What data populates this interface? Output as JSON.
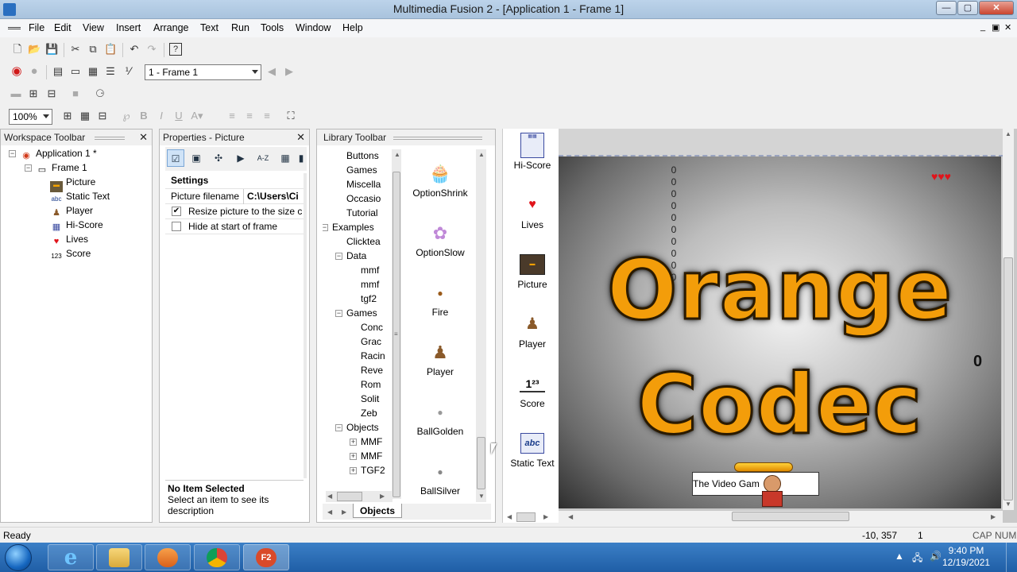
{
  "window": {
    "title": "Multimedia Fusion 2 - [Application 1 - Frame 1]",
    "min": "—",
    "max": "▢",
    "close": "✕",
    "mdi_min": "_",
    "mdi_restore": "▣",
    "mdi_close": "✕"
  },
  "menu": [
    "File",
    "Edit",
    "View",
    "Insert",
    "Arrange",
    "Text",
    "Run",
    "Tools",
    "Window",
    "Help"
  ],
  "toolbar": {
    "frame_select": "1 - Frame 1",
    "zoom": "100%"
  },
  "workspace": {
    "title": "Workspace Toolbar",
    "close": "✕",
    "application": "Application 1 *",
    "frame": "Frame 1",
    "objects": [
      {
        "label": "Picture",
        "icon": "picture-icon"
      },
      {
        "label": "Static Text",
        "icon": "static-text-icon"
      },
      {
        "label": "Player",
        "icon": "player-icon"
      },
      {
        "label": "Hi-Score",
        "icon": "hi-score-icon"
      },
      {
        "label": "Lives",
        "icon": "heart-icon"
      },
      {
        "label": "Score",
        "icon": "score-icon"
      }
    ]
  },
  "properties": {
    "title": "Properties - Picture",
    "close": "✕",
    "section": "Settings",
    "filename_label": "Picture filename",
    "filename_value": "C:\\Users\\Ci",
    "resize_label": "Resize picture to the size c",
    "resize_checked": "✔",
    "hide_label": "Hide at start of frame",
    "desc_title": "No Item Selected",
    "desc_text": "Select an item to see its description"
  },
  "library": {
    "title": "Library Toolbar",
    "tree": [
      {
        "label": "Buttons",
        "level": 2
      },
      {
        "label": "Games",
        "level": 2
      },
      {
        "label": "Miscella",
        "level": 2
      },
      {
        "label": "Occasio",
        "level": 2
      },
      {
        "label": "Tutorial",
        "level": 2
      },
      {
        "label": "Examples",
        "level": 1
      },
      {
        "label": "Clicktea",
        "level": 2
      },
      {
        "label": "Data",
        "level": 2
      },
      {
        "label": "mmf",
        "level": 3
      },
      {
        "label": "mmf",
        "level": 3
      },
      {
        "label": "tgf2",
        "level": 3
      },
      {
        "label": "Games",
        "level": 2
      },
      {
        "label": "Conc",
        "level": 3
      },
      {
        "label": "Grac",
        "level": 3
      },
      {
        "label": "Racin",
        "level": 3
      },
      {
        "label": "Reve",
        "level": 3
      },
      {
        "label": "Rom",
        "level": 3
      },
      {
        "label": "Solit",
        "level": 3
      },
      {
        "label": "Zeb",
        "level": 3
      },
      {
        "label": "Objects",
        "level": 2
      },
      {
        "label": "MMF",
        "level": 3
      },
      {
        "label": "MMF",
        "level": 3
      },
      {
        "label": "TGF2",
        "level": 3
      }
    ],
    "items": [
      "OptionShrink",
      "OptionSlow",
      "Fire",
      "Player",
      "BallGolden",
      "BallSilver"
    ],
    "tab": "Objects"
  },
  "frame_toolbar": [
    "Hi-Score",
    "Lives",
    "Picture",
    "Player",
    "Score",
    "Static Text"
  ],
  "frame": {
    "logo_line1": "Orange",
    "logo_line2": "Codec",
    "hiscore_digits": [
      "0",
      "0",
      "0",
      "0",
      "0",
      "0",
      "0",
      "0",
      "0",
      "0"
    ],
    "score": "0",
    "static_text": "The Video Gam"
  },
  "status": {
    "left": "Ready",
    "coords": "-10, 357",
    "frame_num": "1",
    "caps": "CAP",
    "num": "NUM"
  },
  "taskbar": {
    "time": "9:40 PM",
    "date": "12/19/2021"
  }
}
